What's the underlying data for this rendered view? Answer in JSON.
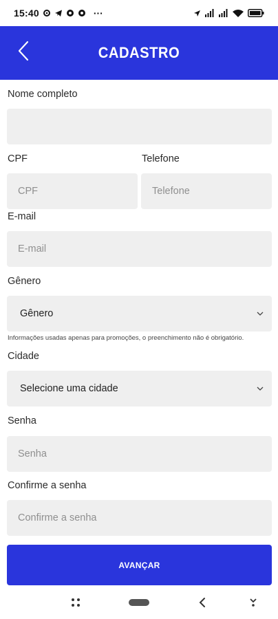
{
  "status_bar": {
    "time": "15:40",
    "notification_icons": [
      "settings-icon",
      "telegram-icon",
      "chrome-icon",
      "chrome-icon"
    ],
    "more": "···",
    "right_icons": [
      "location-arrow-icon",
      "signal-icon",
      "signal-icon",
      "wifi-icon",
      "battery-icon"
    ]
  },
  "app_bar": {
    "title": "CADASTRO",
    "back_icon": "chevron-left-icon",
    "background": "#2a35dc"
  },
  "form": {
    "full_name": {
      "label": "Nome completo",
      "placeholder": ""
    },
    "cpf": {
      "label": "CPF",
      "placeholder": "CPF"
    },
    "phone": {
      "label": "Telefone",
      "placeholder": "Telefone"
    },
    "email": {
      "label": "E-mail",
      "placeholder": "E-mail"
    },
    "gender": {
      "label": "Gênero",
      "value": "Gênero"
    },
    "gender_hint": "Informações usadas apenas para promoções, o preenchimento não é obrigatório.",
    "city": {
      "label": "Cidade",
      "value": "Selecione uma cidade"
    },
    "password": {
      "label": "Senha",
      "placeholder": "Senha"
    },
    "confirm_password": {
      "label": "Confirme a senha",
      "placeholder": "Confirme a senha"
    }
  },
  "submit": {
    "label": "AVANÇAR"
  },
  "nav_bar": {
    "icons": [
      "apps-grid-icon",
      "home-pill-icon",
      "back-icon",
      "keyboard-hide-icon"
    ]
  },
  "colors": {
    "primary": "#2a35dc",
    "field_bg": "#efefef"
  }
}
